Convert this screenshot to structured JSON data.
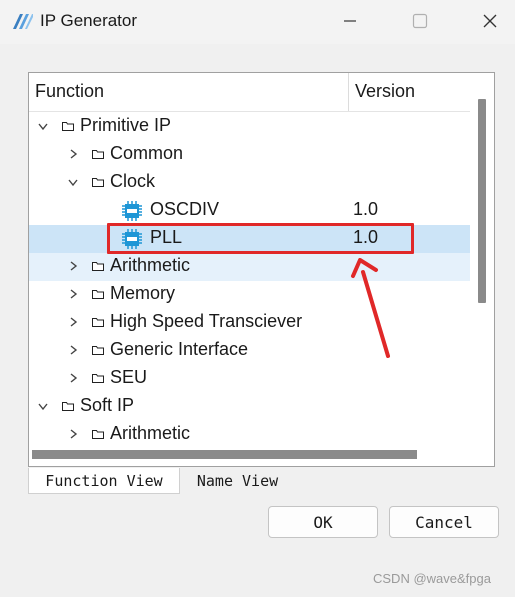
{
  "window": {
    "title": "IP Generator",
    "controls": [
      "minimize",
      "maximize",
      "close"
    ]
  },
  "tree": {
    "columns": {
      "function": "Function",
      "version": "Version"
    },
    "rows": [
      {
        "label": "Primitive IP",
        "version": "",
        "expanded": true,
        "icon": "folder-icon"
      },
      {
        "label": "Common",
        "version": "",
        "expanded": false,
        "icon": "folder-icon"
      },
      {
        "label": "Clock",
        "version": "",
        "expanded": true,
        "icon": "folder-icon"
      },
      {
        "label": "OSCDIV",
        "version": "1.0",
        "icon": "ram-chip-icon"
      },
      {
        "label": "PLL",
        "version": "1.0",
        "icon": "ram-chip-icon",
        "selected": true
      },
      {
        "label": "Arithmetic",
        "version": "",
        "expanded": false,
        "icon": "folder-icon"
      },
      {
        "label": "Memory",
        "version": "",
        "expanded": false,
        "icon": "folder-icon"
      },
      {
        "label": "High Speed Transciever",
        "version": "",
        "expanded": false,
        "icon": "folder-icon"
      },
      {
        "label": "Generic Interface",
        "version": "",
        "expanded": false,
        "icon": "folder-icon"
      },
      {
        "label": "SEU",
        "version": "",
        "expanded": false,
        "icon": "folder-icon"
      },
      {
        "label": "Soft IP",
        "version": "",
        "expanded": true,
        "icon": "folder-icon"
      },
      {
        "label": "Arithmetic",
        "version": "",
        "expanded": false,
        "icon": "folder-icon"
      }
    ]
  },
  "tabs": [
    {
      "label": "Function View",
      "active": true
    },
    {
      "label": "Name View",
      "active": false
    }
  ],
  "buttons": {
    "ok": "OK",
    "cancel": "Cancel"
  },
  "watermark": "CSDN @wave&fpga",
  "colors": {
    "annotation": "#e02828",
    "selection": "#cce4f7",
    "hover": "#e5f1fb"
  }
}
